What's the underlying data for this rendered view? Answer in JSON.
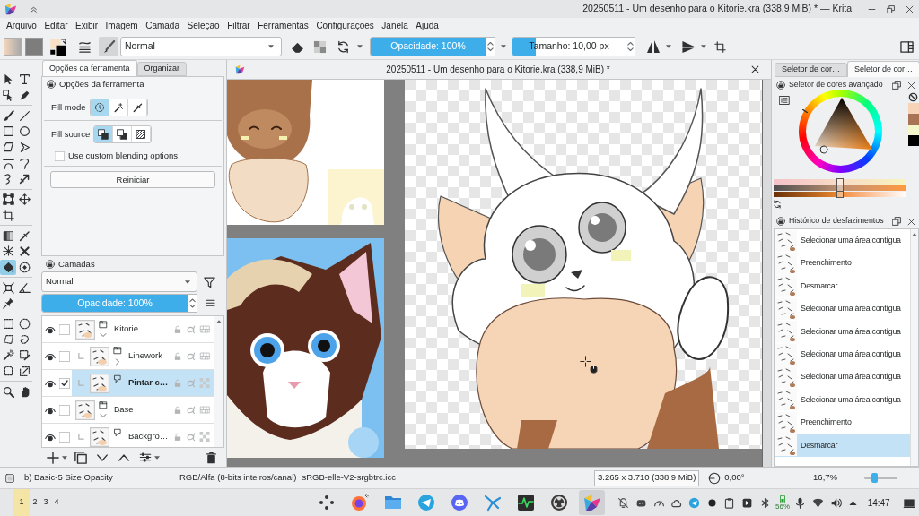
{
  "title_bar": {
    "title": "20250511 - Um desenho para o Kitorie.kra (338,9 MiB) * — Krita"
  },
  "menu_bar": [
    "Arquivo",
    "Editar",
    "Exibir",
    "Imagem",
    "Camada",
    "Seleção",
    "Filtrar",
    "Ferramentas",
    "Configurações",
    "Janela",
    "Ajuda"
  ],
  "toolbar": {
    "blend_mode": "Normal",
    "opacity": {
      "label": "Opacidade: 100%",
      "level": 1
    },
    "size": {
      "label": "Tamanho: 10,00 px",
      "level": 0.21
    }
  },
  "toolbox": [
    [
      {
        "selected": false
      },
      {
        "selected": false
      },
      {
        "selected": false
      },
      {
        "selected": false
      }
    ],
    [
      {
        "selected": false
      },
      {
        "selected": false
      },
      {
        "selected": false
      },
      {
        "selected": false
      },
      {
        "selected": false
      },
      {
        "selected": false
      },
      {
        "selected": false
      },
      {
        "selected": false
      },
      {
        "selected": false
      },
      {
        "selected": false
      }
    ],
    [
      {
        "selected": false
      },
      {
        "selected": false
      },
      {
        "selected": false
      }
    ],
    [
      {
        "selected": false
      },
      {
        "selected": false
      },
      {
        "selected": false
      },
      {
        "selected": false
      },
      {
        "selected": true
      },
      {
        "selected": false
      }
    ],
    [
      {
        "selected": false
      },
      {
        "selected": false
      },
      {
        "selected": false
      }
    ],
    [
      {
        "selected": false
      },
      {
        "selected": false
      },
      {
        "selected": false
      },
      {
        "selected": false
      },
      {
        "selected": false
      },
      {
        "selected": false
      },
      {
        "selected": false
      },
      {
        "selected": false
      }
    ],
    [
      {
        "selected": false
      },
      {
        "selected": false
      }
    ]
  ],
  "tool_options": {
    "tabs": [
      {
        "label": "Opções da ferramenta",
        "selected": true
      },
      {
        "label": "Organizar",
        "selected": false
      }
    ],
    "title": "Opções da ferramenta",
    "fill_mode": {
      "label": "Fill mode",
      "options": [
        {
          "selected": true
        },
        {
          "selected": false
        },
        {
          "selected": false
        }
      ]
    },
    "fill_source": {
      "label": "Fill source",
      "options": [
        {
          "selected": true
        },
        {
          "selected": false
        },
        {
          "selected": false
        }
      ]
    },
    "custom_blending": {
      "label": "Use custom blending options",
      "checked": false
    },
    "reset_button": "Reiniciar"
  },
  "layers": {
    "title": "Camadas",
    "blend_mode": "Normal",
    "opacity": {
      "label": "Opacidade: 100%",
      "level": 1
    },
    "items": [
      {
        "name": "Kitorie",
        "kind": "group",
        "visible": true,
        "checked": false,
        "selected": false,
        "expanded": true,
        "children": [
          {
            "name": "Linework",
            "kind": "group",
            "visible": true,
            "checked": false,
            "selected": false,
            "expanded": false
          },
          {
            "name": "Pintar c…",
            "kind": "paint",
            "visible": true,
            "checked": true,
            "selected": true
          }
        ]
      },
      {
        "name": "Base",
        "kind": "group",
        "visible": true,
        "checked": false,
        "selected": false,
        "expanded": true,
        "children": [
          {
            "name": "Backgro…",
            "kind": "paint",
            "visible": true,
            "checked": false,
            "selected": false
          }
        ]
      }
    ]
  },
  "document": {
    "title": "20250511 - Um desenho para o Kitorie.kra (338,9 MiB) *"
  },
  "color_selector": {
    "tabs": [
      {
        "label": "Seletor de cor…",
        "selected": false
      },
      {
        "label": "Seletor de cor…",
        "selected": true
      }
    ],
    "title": "Seletor de cores avançado",
    "swatches": [
      {
        "color": "#f7d3b8"
      },
      {
        "color": "#a97455"
      },
      {
        "color": "#f5f6c9"
      },
      {
        "color": "#000000"
      }
    ],
    "sliders": [
      {
        "level": 0.5
      },
      {
        "level": 0.5
      },
      {
        "level": 0.5
      }
    ]
  },
  "history": {
    "title": "Histórico de desfazimentos",
    "items": [
      {
        "label": "Selecionar uma área contígua",
        "selected": false
      },
      {
        "label": "Preenchimento",
        "selected": false
      },
      {
        "label": "Desmarcar",
        "selected": false
      },
      {
        "label": "Selecionar uma área contígua",
        "selected": false
      },
      {
        "label": "Selecionar uma área contígua",
        "selected": false
      },
      {
        "label": "Selecionar uma área contígua",
        "selected": false
      },
      {
        "label": "Selecionar uma área contígua",
        "selected": false
      },
      {
        "label": "Selecionar uma área contígua",
        "selected": false
      },
      {
        "label": "Preenchimento",
        "selected": false
      },
      {
        "label": "Desmarcar",
        "selected": true
      }
    ]
  },
  "status_bar": {
    "brush_preset": "b) Basic-5 Size Opacity",
    "color_space": "RGB/Alfa (8-bits inteiros/canal)",
    "profile": "sRGB-elle-V2-srgbtrc.icc",
    "image_size": "3.265 x 3.710 (338,9 MiB)",
    "rotation": "0,00°",
    "zoom": {
      "label": "16,7%",
      "level": 0.3
    }
  },
  "taskbar": {
    "pager": [
      {
        "label": "1",
        "selected": true
      },
      {
        "label": "2",
        "selected": false
      },
      {
        "label": "3",
        "selected": false
      },
      {
        "label": "4",
        "selected": false
      }
    ],
    "apps": [
      {
        "active": false
      },
      {
        "active": false
      },
      {
        "active": false
      },
      {
        "active": false
      },
      {
        "active": false
      },
      {
        "active": false
      },
      {
        "active": false
      },
      {
        "active": false
      },
      {
        "active": true
      }
    ],
    "battery": "56%",
    "clock": "14:47"
  }
}
